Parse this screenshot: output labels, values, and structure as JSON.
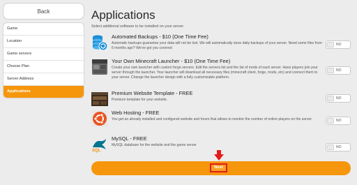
{
  "sidebar": {
    "back_label": "Back",
    "items": [
      {
        "label": "Game"
      },
      {
        "label": "Location"
      },
      {
        "label": "Game servers"
      },
      {
        "label": "Choose Plan"
      },
      {
        "label": "Server Address"
      },
      {
        "label": "Applications"
      }
    ],
    "active_index": 5
  },
  "main": {
    "title": "Applications",
    "subtitle": "Select additional software to be installed on your server",
    "apps": [
      {
        "name": "Automated Backups - $10 (One Time Fee)",
        "description": "Automatic backups guarantee your data will not be lost. We will automatically store daily backups of your server. Need some files from 6 months ago? We've got you covered",
        "toggle_label": "NO",
        "icon": "database-backup-icon"
      },
      {
        "name": "Your Own Minecraft Launcher - $10 (One Time Fee)",
        "description": "Create your own launcher with custom forge servers. Edit the servers list and the list of mods of each server. Have players join your server through the launcher. Your launcher will download all necessary files (minecraft client, forge, mods, etc) and connect them to your server. Change the launcher design with a fully customizable platform.",
        "toggle_label": "NO",
        "icon": "launcher-icon"
      },
      {
        "name": "Premium Website Template - FREE",
        "description": "Premium template for your website.",
        "toggle_label": "NO",
        "icon": "website-template-icon"
      },
      {
        "name": "Web Hosting - FREE",
        "description": "You get an already installed and configured website and forum that allows to monitor the number of online players on the server.",
        "toggle_label": "NO",
        "icon": "ubuntu-icon"
      },
      {
        "name": "MySQL - FREE",
        "description": "MySQL database for the website and the game server",
        "toggle_label": "NO",
        "icon": "mysql-icon"
      }
    ]
  },
  "footer": {
    "next_label": "Next"
  },
  "colors": {
    "accent": "#f5960c",
    "highlight": "#e31b1b"
  }
}
